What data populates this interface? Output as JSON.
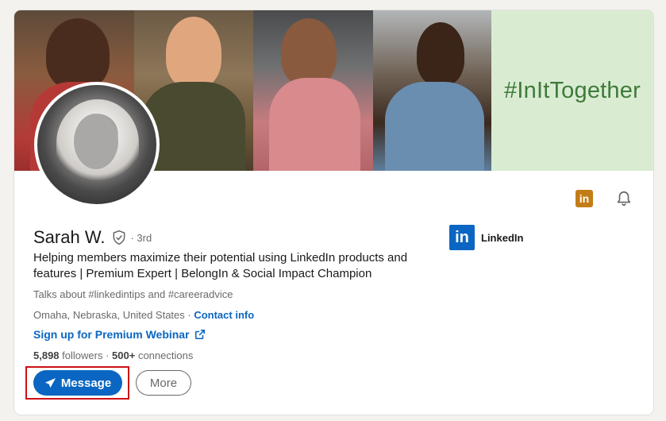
{
  "banner": {
    "hashtag": "#InItTogether",
    "accent_color": "#3f7a3a"
  },
  "profile": {
    "name": "Sarah W.",
    "degree": "· 3rd",
    "headline": "Helping members maximize their potential using LinkedIn products and features | Premium Expert | BelongIn & Social Impact Champion",
    "talks_about": "Talks about #linkedintips and #careeradvice",
    "location": "Omaha, Nebraska, United States",
    "location_separator": " · ",
    "contact_info": "Contact info",
    "webinar_link": "Sign up for Premium Webinar",
    "followers_count": "5,898",
    "followers_label": " followers",
    "connections_prefix": " · ",
    "connections_count": "500+",
    "connections_label": " connections"
  },
  "company": {
    "logo_text": "in",
    "name": "LinkedIn"
  },
  "top_icons": {
    "linkedin_small": "in"
  },
  "actions": {
    "message_label": "Message",
    "more_label": "More"
  },
  "colors": {
    "brand_blue": "#0a66c2",
    "highlight_red": "#cc1016",
    "premium_gold": "#c37d16"
  }
}
